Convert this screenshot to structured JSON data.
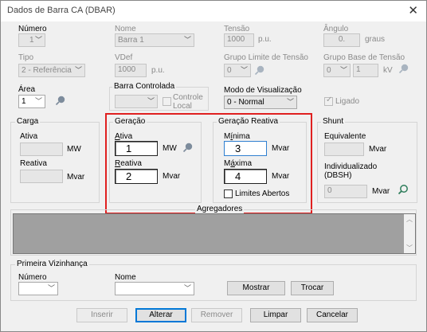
{
  "window": {
    "title": "Dados de Barra CA (DBAR)"
  },
  "row1": {
    "numero_label": "Número",
    "numero_value": "1",
    "nome_label": "Nome",
    "nome_value": "Barra 1",
    "tensao_label": "Tensão",
    "tensao_value": "1000",
    "tensao_unit": "p.u.",
    "angulo_label": "Ângulo",
    "angulo_value": "0.",
    "angulo_unit": "graus"
  },
  "row2": {
    "tipo_label": "Tipo",
    "tipo_value": "2 - Referência",
    "vdef_label": "VDef",
    "vdef_value": "1000",
    "vdef_unit": "p.u.",
    "grupo_limite_label": "Grupo Limite de Tensão",
    "grupo_limite_value": "0",
    "grupo_base_label": "Grupo Base de Tensão",
    "grupo_base_value": "0",
    "grupo_base_kv": "1",
    "grupo_base_unit": "kV"
  },
  "row3": {
    "area_label": "Área",
    "area_value": "1",
    "barra_controlada_label": "Barra Controlada",
    "controle_local_label": "Controle Local",
    "modo_label": "Modo de Visualização",
    "modo_value": "0 - Normal",
    "ligado_label": "Ligado"
  },
  "carga": {
    "title": "Carga",
    "ativa_label": "Ativa",
    "ativa_unit": "MW",
    "reativa_label": "Reativa",
    "reativa_unit": "Mvar"
  },
  "geracao": {
    "title": "Geração",
    "ativa_label": "Ativa",
    "ativa_value": "1",
    "ativa_unit": "MW",
    "reativa_label": "Reativa",
    "reativa_value": "2",
    "reativa_unit": "Mvar"
  },
  "geracao_reativa": {
    "title": "Geração Reativa",
    "minima_label": "Mínima",
    "minima_value": "3",
    "minima_unit": "Mvar",
    "maxima_label": "Máxima",
    "maxima_value": "4",
    "maxima_unit": "Mvar",
    "limites_label": "Limites Abertos"
  },
  "shunt": {
    "title": "Shunt",
    "equivalente_label": "Equivalente",
    "equivalente_unit": "Mvar",
    "individualizado_label": "Individualizado",
    "dbsh_label": "(DBSH)",
    "individualizado_value": "0",
    "individualizado_unit": "Mvar"
  },
  "agregadores": {
    "title": "Agregadores"
  },
  "vizinhanca": {
    "title": "Primeira Vizinhança",
    "numero_label": "Número",
    "nome_label": "Nome",
    "mostrar_label": "Mostrar",
    "trocar_label": "Trocar"
  },
  "buttons": {
    "inserir": "Inserir",
    "alterar": "Alterar",
    "remover": "Remover",
    "limpar": "Limpar",
    "cancelar": "Cancelar"
  },
  "icons": {
    "close": "close-icon",
    "pin": "pin-icon",
    "dropdown": "chevron-down-icon",
    "scroll_up": "arrow-up-icon",
    "scroll_down": "arrow-down-icon"
  },
  "colors": {
    "highlight": "#e02020",
    "default_button": "#0078d7",
    "agregadores_bg": "#a0a0a0"
  }
}
